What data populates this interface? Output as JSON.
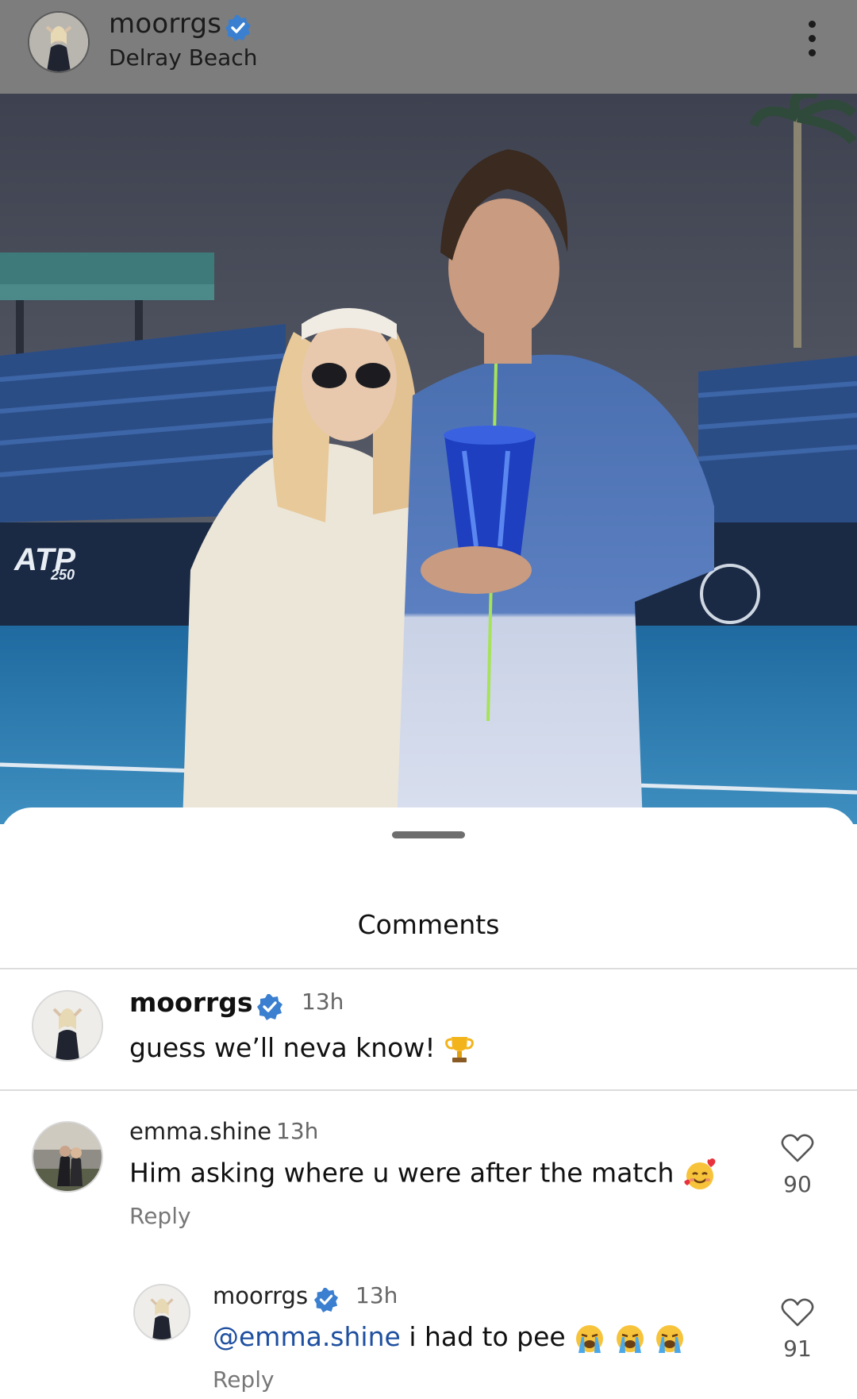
{
  "post_header": {
    "username": "moorrgs",
    "verified": true,
    "location": "Delray Beach",
    "menu_icon": "more-vertical-icon"
  },
  "photo": {
    "signage": [
      "ATP",
      "250"
    ]
  },
  "comments_sheet": {
    "title": "Comments",
    "comments": [
      {
        "username": "moorrgs",
        "verified": true,
        "time": "13h",
        "text": "guess we’ll neva know!",
        "emoji": "trophy-emoji"
      },
      {
        "username": "emma.shine",
        "time": "13h",
        "text": "Him asking where u were  after the match",
        "emoji": "smiling-face-with-hearts-emoji",
        "reply_label": "Reply",
        "likes": "90",
        "replies": [
          {
            "username": "moorrgs",
            "verified": true,
            "time": "13h",
            "mention": "@emma.shine",
            "text": "i had to pee",
            "emoji": "loudly-crying-face-emoji",
            "reply_label": "Reply",
            "likes": "91"
          }
        ]
      }
    ]
  },
  "colors": {
    "header_bg": "#7d7d7d",
    "verified_blue": "#3897f0",
    "mention_blue": "#1e4fa0",
    "sheet_bg": "#ffffff"
  }
}
